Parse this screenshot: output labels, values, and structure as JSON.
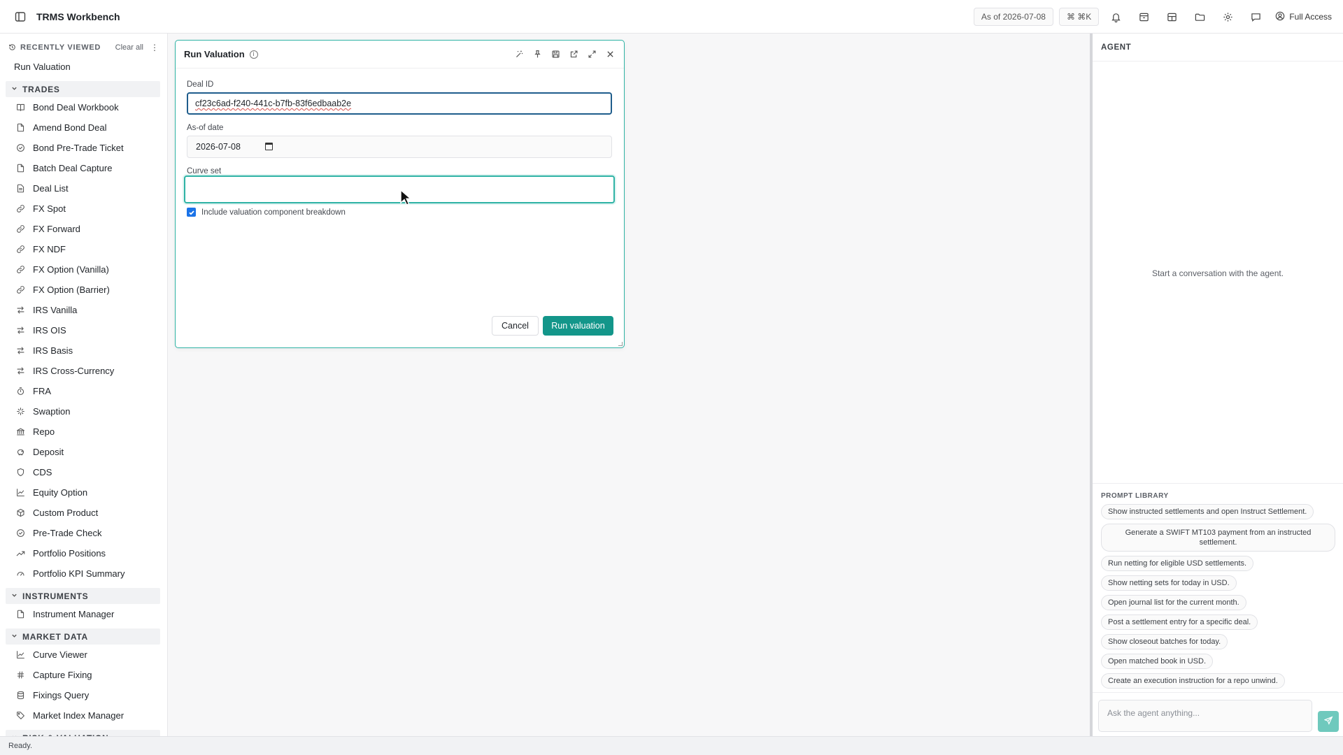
{
  "app": {
    "title": "TRMS Workbench"
  },
  "topbar": {
    "as_of": "As of 2026-07-08",
    "shortcut": "⌘ ⌘K",
    "access": "Full Access"
  },
  "sidebar": {
    "recently_viewed_label": "RECENTLY VIEWED",
    "clear_all": "Clear all",
    "recent_items": [
      "Run Valuation"
    ],
    "sections": [
      {
        "title": "TRADES",
        "items": [
          {
            "label": "Bond Deal Workbook",
            "icon": "book-icon"
          },
          {
            "label": "Amend Bond Deal",
            "icon": "file-edit-icon"
          },
          {
            "label": "Bond Pre-Trade Ticket",
            "icon": "check-circle-icon"
          },
          {
            "label": "Batch Deal Capture",
            "icon": "file-edit-icon"
          },
          {
            "label": "Deal List",
            "icon": "document-icon"
          },
          {
            "label": "FX Spot",
            "icon": "link-icon"
          },
          {
            "label": "FX Forward",
            "icon": "link-icon"
          },
          {
            "label": "FX NDF",
            "icon": "link-icon"
          },
          {
            "label": "FX Option (Vanilla)",
            "icon": "link-icon"
          },
          {
            "label": "FX Option (Barrier)",
            "icon": "link-icon"
          },
          {
            "label": "IRS Vanilla",
            "icon": "swap-icon"
          },
          {
            "label": "IRS OIS",
            "icon": "swap-icon"
          },
          {
            "label": "IRS Basis",
            "icon": "swap-icon"
          },
          {
            "label": "IRS Cross-Currency",
            "icon": "swap-icon"
          },
          {
            "label": "FRA",
            "icon": "timer-icon"
          },
          {
            "label": "Swaption",
            "icon": "sparkle-icon"
          },
          {
            "label": "Repo",
            "icon": "bank-icon"
          },
          {
            "label": "Deposit",
            "icon": "piggy-bank-icon"
          },
          {
            "label": "CDS",
            "icon": "shield-icon"
          },
          {
            "label": "Equity Option",
            "icon": "line-chart-icon"
          },
          {
            "label": "Custom Product",
            "icon": "box-icon"
          },
          {
            "label": "Pre-Trade Check",
            "icon": "check-circle-icon"
          },
          {
            "label": "Portfolio Positions",
            "icon": "trending-up-icon"
          },
          {
            "label": "Portfolio KPI Summary",
            "icon": "gauge-icon"
          }
        ]
      },
      {
        "title": "INSTRUMENTS",
        "items": [
          {
            "label": "Instrument Manager",
            "icon": "file-edit-icon"
          }
        ]
      },
      {
        "title": "MARKET DATA",
        "items": [
          {
            "label": "Curve Viewer",
            "icon": "line-chart-icon"
          },
          {
            "label": "Capture Fixing",
            "icon": "hash-icon"
          },
          {
            "label": "Fixings Query",
            "icon": "database-icon"
          },
          {
            "label": "Market Index Manager",
            "icon": "tag-icon"
          }
        ]
      },
      {
        "title": "RISK & VALUATION",
        "items": []
      }
    ]
  },
  "dialog": {
    "title": "Run Valuation",
    "deal_id_label": "Deal ID",
    "deal_id_value": "cf23c6ad-f240-441c-b7fb-83f6edbaab2e",
    "as_of_label": "As-of date",
    "as_of_value": "2026-07-08",
    "curve_set_label": "Curve set",
    "curve_set_value": "",
    "breakdown_label": "Include valuation component breakdown",
    "breakdown_checked": true,
    "cancel_label": "Cancel",
    "run_label": "Run valuation"
  },
  "agent": {
    "header": "AGENT",
    "empty_text": "Start a conversation with the agent.",
    "prompt_library_title": "PROMPT LIBRARY",
    "prompts": [
      "Show instructed settlements and open Instruct Settlement.",
      "Generate a SWIFT MT103 payment from an instructed settlement.",
      "Run netting for eligible USD settlements.",
      "Show netting sets for today in USD.",
      "Open journal list for the current month.",
      "Post a settlement entry for a specific deal.",
      "Show closeout batches for today.",
      "Open matched book in USD.",
      "Create an execution instruction for a repo unwind."
    ],
    "input_placeholder": "Ask the agent anything..."
  },
  "status": {
    "text": "Ready."
  },
  "colors": {
    "accent": "#13968a",
    "focus_blue": "#1f5d8c",
    "checkbox": "#1a73e8"
  }
}
